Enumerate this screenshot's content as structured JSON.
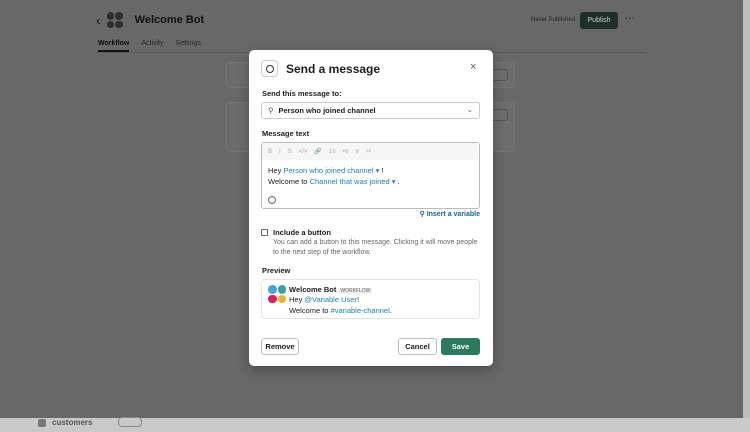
{
  "header": {
    "title": "Welcome Bot",
    "status": "Never Published",
    "publish": "Publish",
    "more": "···",
    "back": "‹"
  },
  "tabs": [
    "Workflow",
    "Activity",
    "Settings"
  ],
  "bottom": {
    "channel": "customers"
  },
  "modal": {
    "title": "Send a message",
    "close": "×",
    "send_to_label": "Send this message to:",
    "send_to_value": "Person who joined channel",
    "message_label": "Message text",
    "toolbar": [
      "B",
      "I",
      "S",
      "</>",
      "🔗",
      "1≡",
      "•≡",
      "≡",
      "⏎"
    ],
    "line1_prefix": "Hey",
    "line1_var": "Person who joined channel ▾",
    "line1_suffix": "!",
    "line2_prefix": "Welcome to",
    "line2_var": "Channel that was joined ▾",
    "line2_suffix": ".",
    "insert_variable": "Insert a variable",
    "include_button_label": "Include a button",
    "include_button_desc": "You can add a button to this message. Clicking it will move people to the next step of the workflow.",
    "preview_label": "Preview",
    "preview": {
      "name": "Welcome Bot",
      "badge": "WORKFLOW",
      "l1_prefix": "Hey",
      "l1_var": "@Variable User",
      "l1_suffix": "!",
      "l2_prefix": "Welcome to",
      "l2_var": "#variable-channel",
      "l2_suffix": "."
    },
    "remove": "Remove",
    "cancel": "Cancel",
    "save": "Save"
  },
  "colors": {
    "primary": "#2b7a5e",
    "link": "#1d7fb3"
  }
}
